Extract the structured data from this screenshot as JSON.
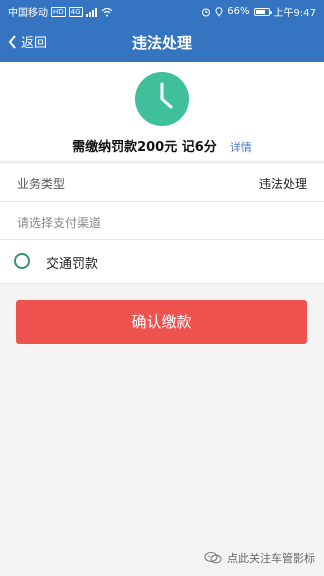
{
  "status_bar": {
    "carrier": "中国移动",
    "network_badge_1": "HD",
    "network_badge_2": "4G",
    "battery_percent": "66%",
    "time": "上午9:47"
  },
  "header": {
    "back_label": "返回",
    "title": "违法处理"
  },
  "summary": {
    "fine_text": "需缴纳罚款200元 记6分",
    "details_link": "详情"
  },
  "business_type": {
    "label": "业务类型",
    "value": "违法处理"
  },
  "payment": {
    "channel_hint": "请选择支付渠道",
    "options": [
      {
        "label": "交通罚款"
      }
    ]
  },
  "actions": {
    "confirm_label": "确认缴款"
  },
  "watermark": {
    "text": "点此关注车管影标"
  },
  "colors": {
    "header": "#3474c0",
    "accent_green": "#3fc09b",
    "radio_green": "#3b8f75",
    "confirm_red": "#ef5350",
    "link_blue": "#4b78c8"
  },
  "icons": {
    "clock": "clock-icon",
    "back": "chevron-left-icon",
    "radio": "radio-button-icon",
    "watermark": "wechat-icon"
  }
}
